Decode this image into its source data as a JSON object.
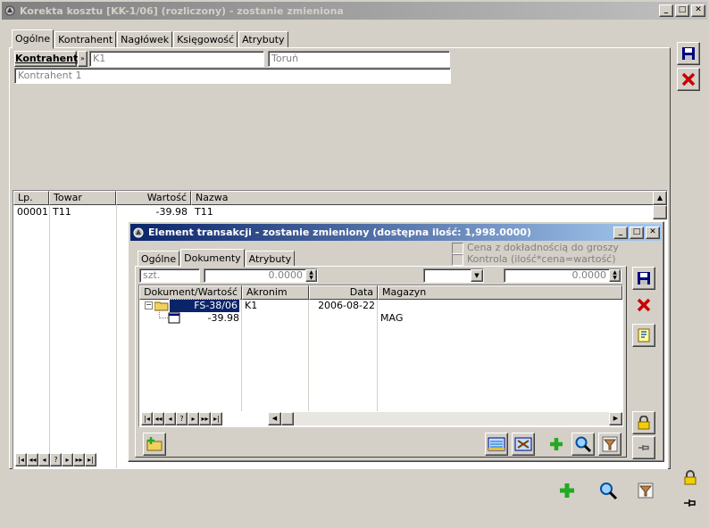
{
  "main_window": {
    "title": "Korekta kosztu [KK-1/06] (rozliczony) - zostanie zmieniona",
    "tabs": [
      "Ogólne",
      "Kontrahent",
      "Nagłówek",
      "Księgowość",
      "Atrybuty"
    ],
    "kontrahent_button": "Kontrahent",
    "kontrahent_code": "K1",
    "kontrahent_city": "Toruń",
    "kontrahent_name": "Kontrahent 1",
    "columns": [
      "Lp.",
      "Towar",
      "Wartość",
      "Nazwa"
    ],
    "rows": [
      {
        "lp": "00001",
        "towar": "T11",
        "wartosc": "-39.98",
        "nazwa": "T11"
      }
    ]
  },
  "dialog": {
    "title": "Element transakcji - zostanie zmieniony (dostępna ilość: 1,998.0000)",
    "tabs": [
      "Ogólne",
      "Dokumenty",
      "Atrybuty"
    ],
    "checkbox_precision": "Cena z dokładnością do groszy",
    "checkbox_control": "Kontrola (ilość*cena=wartość)",
    "unit": "szt.",
    "quantity": "0.0000",
    "amount": "0.0000",
    "columns": [
      "Dokument/Wartość",
      "Akronim",
      "Data",
      "Magazyn"
    ],
    "tree": [
      {
        "document": "FS-38/06",
        "akronim": "K1",
        "data": "2006-08-22",
        "magazyn": ""
      },
      {
        "document": "-39.98",
        "akronim": "",
        "data": "",
        "magazyn": "MAG"
      }
    ]
  },
  "nav_buttons": [
    "|◂",
    "◂◂",
    "◂",
    "?",
    "▸",
    "▸▸",
    "▸|"
  ],
  "colors": {
    "save": "#000080",
    "delete": "#cc0000",
    "add": "#22aa22",
    "selection": "#0a246a"
  }
}
